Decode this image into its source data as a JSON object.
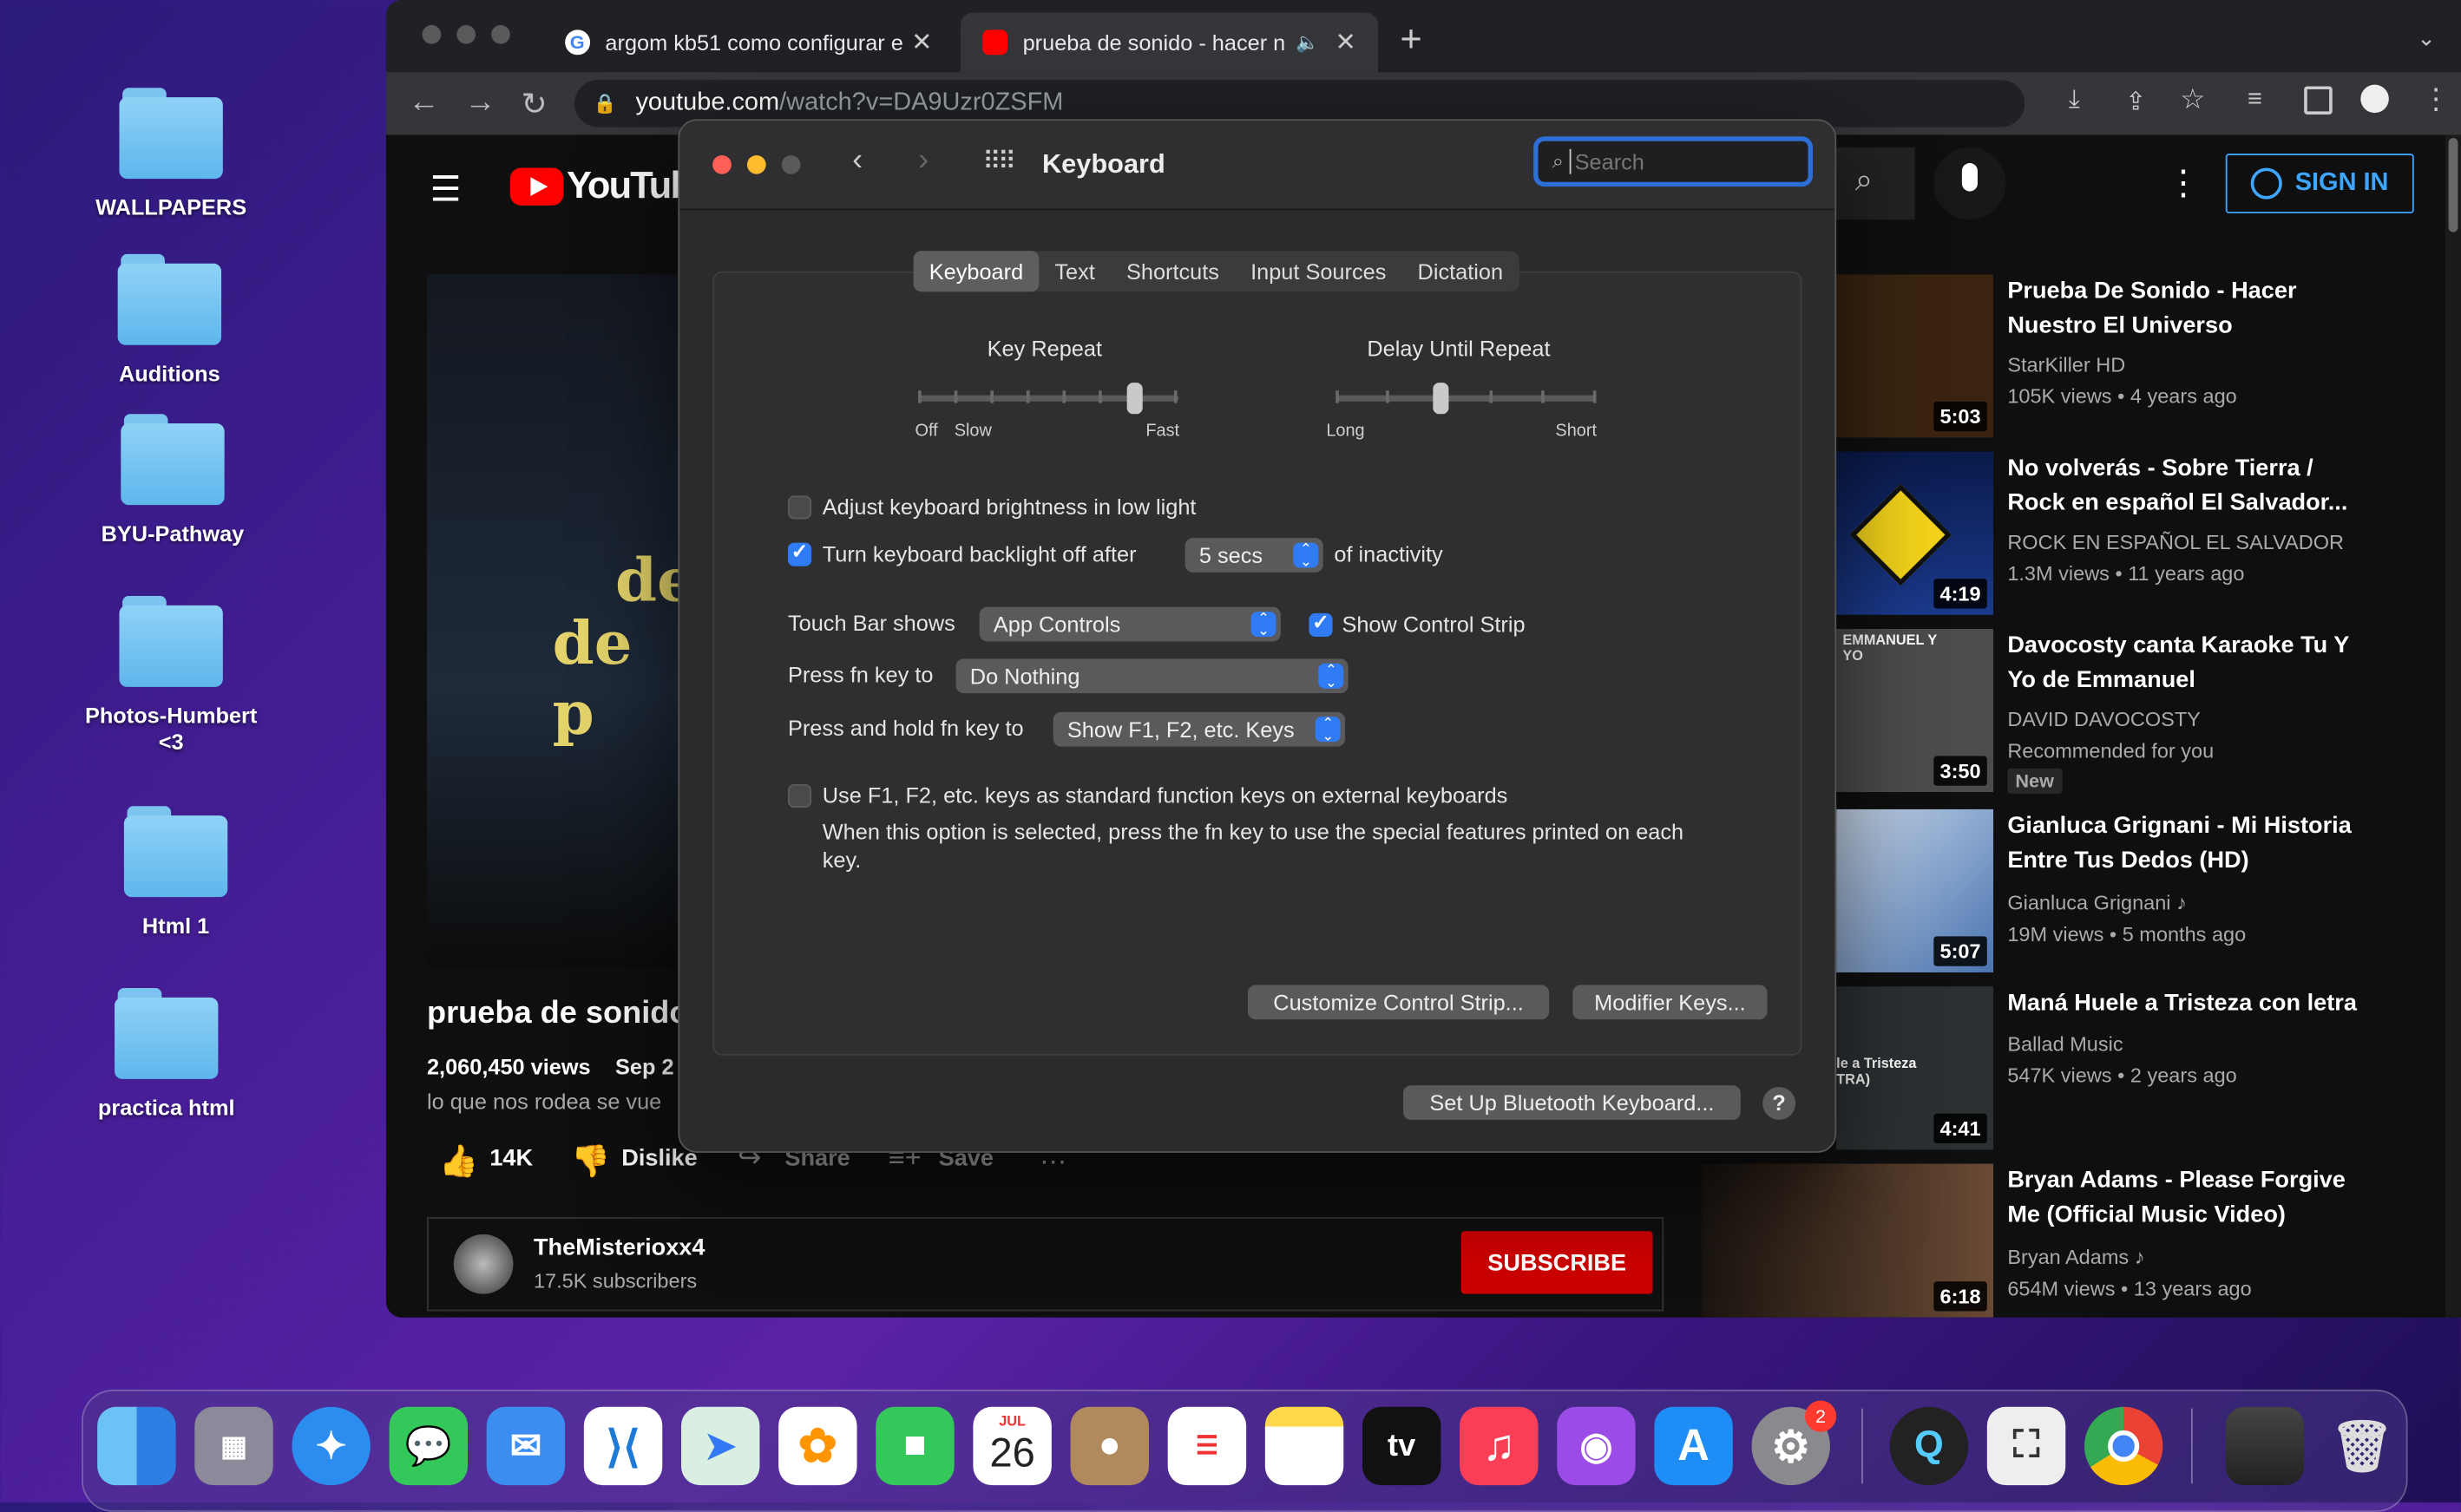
{
  "desktop": {
    "folders": [
      "WALLPAPERS",
      "Auditions",
      "BYU-Pathway",
      "Photos-Humbert <3",
      "Html 1",
      "practica html"
    ]
  },
  "browser": {
    "tabs": [
      {
        "title": "argom kb51 como configurar e"
      },
      {
        "title": "prueba de sonido - hacer n"
      }
    ],
    "url_host": "youtube.com",
    "url_path": "/watch?v=DA9Uzr0ZSFM"
  },
  "youtube": {
    "logo_text": "YouTube",
    "sign_in": "SIGN IN",
    "video": {
      "title": "prueba de sonido",
      "views": "2,060,450 views",
      "date": "Sep 2",
      "description": "lo que nos rodea se vue",
      "overlay_text_1": "de",
      "overlay_text_2": "de p",
      "likes": "14K",
      "dislike": "Dislike",
      "share": "Share",
      "save": "Save",
      "channel": "TheMisterioxx4",
      "subscribers": "17.5K subscribers",
      "subscribe": "SUBSCRIBE"
    },
    "related": [
      {
        "title": "Prueba De Sonido - Hacer Nuestro El Universo",
        "channel": "StarKiller HD",
        "meta": "105K views • 4 years ago",
        "duration": "5:03",
        "thumb_color": "#3a2410",
        "extra": ""
      },
      {
        "title": "No volverás - Sobre Tierra / Rock en español El Salvador...",
        "channel": "ROCK EN ESPAÑOL EL SALVADOR",
        "meta": "1.3M views • 11 years ago",
        "duration": "4:19",
        "thumb_color": "#1b2a5c",
        "extra": ""
      },
      {
        "title": "Davocosty canta Karaoke Tu Y Yo de Emmanuel",
        "channel": "DAVID DAVOCOSTY",
        "meta": "Recommended for you",
        "duration": "3:50",
        "thumb_color": "#4c4c4c",
        "extra": "New",
        "thumb_text": "EMMANUEL Y YO"
      },
      {
        "title": "Gianluca Grignani - Mi Historia Entre Tus Dedos (HD)",
        "channel": "Gianluca Grignani",
        "meta": "19M views • 5 months ago",
        "duration": "5:07",
        "thumb_color": "#6c8fc0",
        "extra": ""
      },
      {
        "title": "Maná Huele a Tristeza con letra",
        "channel": "Ballad Music",
        "meta": "547K views • 2 years ago",
        "duration": "4:41",
        "thumb_color": "#2c3032",
        "extra": "",
        "thumb_text": "le a Tristeza TRA)"
      },
      {
        "title": "Bryan Adams - Please Forgive Me (Official Music Video)",
        "channel": "Bryan Adams",
        "meta": "654M views • 13 years ago",
        "duration": "6:18",
        "thumb_color": "#3a2a20",
        "extra": ""
      }
    ]
  },
  "prefs": {
    "title": "Keyboard",
    "search_placeholder": "Search",
    "tabs": [
      "Keyboard",
      "Text",
      "Shortcuts",
      "Input Sources",
      "Dictation"
    ],
    "key_repeat": {
      "label": "Key Repeat",
      "left1": "Off",
      "left2": "Slow",
      "right": "Fast",
      "level": 0.83
    },
    "delay_repeat": {
      "label": "Delay Until Repeat",
      "left": "Long",
      "right": "Short",
      "level": 0.4
    },
    "adjust_brightness": {
      "label": "Adjust keyboard brightness in low light",
      "checked": false
    },
    "backlight_off": {
      "label": "Turn keyboard backlight off after",
      "value": "5 secs",
      "suffix": "of inactivity",
      "checked": true
    },
    "touchbar": {
      "label": "Touch Bar shows",
      "value": "App Controls"
    },
    "control_strip": {
      "label": "Show Control Strip",
      "checked": true
    },
    "fn_key": {
      "label": "Press fn key to",
      "value": "Do Nothing"
    },
    "fn_hold": {
      "label": "Press and hold fn key to",
      "value": "Show F1, F2, etc. Keys"
    },
    "std_fn": {
      "label": "Use F1, F2, etc. keys as standard function keys on external keyboards",
      "desc": "When this option is selected, press the fn key to use the special features printed on each key.",
      "checked": false
    },
    "customize_button": "Customize Control Strip...",
    "modifier_button": "Modifier Keys...",
    "bluetooth_button": "Set Up Bluetooth Keyboard...",
    "help": "?"
  },
  "dock": {
    "calendar_month": "JUL",
    "calendar_day": "26",
    "tv_label": "tv",
    "settings_badge": "2"
  }
}
